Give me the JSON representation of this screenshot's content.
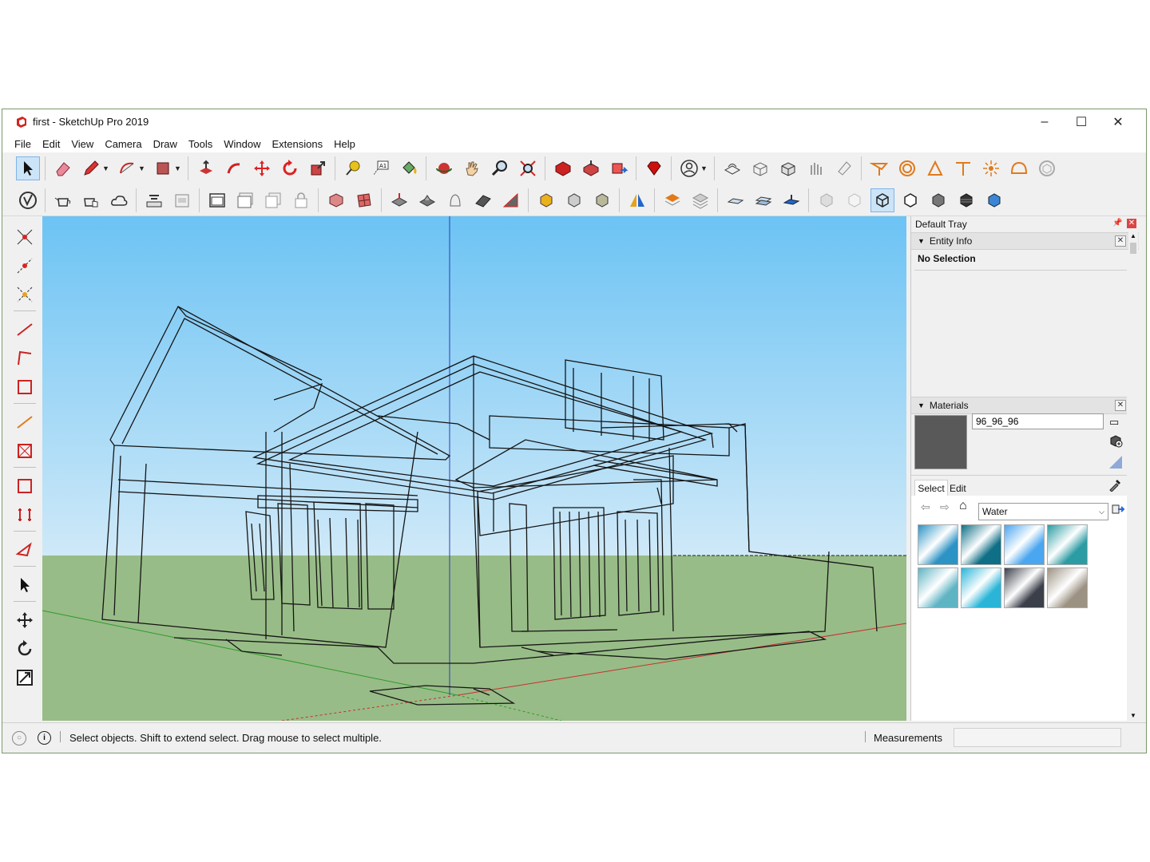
{
  "window": {
    "title": "first - SketchUp Pro 2019"
  },
  "menu": [
    "File",
    "Edit",
    "View",
    "Camera",
    "Draw",
    "Tools",
    "Window",
    "Extensions",
    "Help"
  ],
  "tray": {
    "title": "Default Tray",
    "entity_info": {
      "header": "Entity Info",
      "selection": "No Selection"
    },
    "materials": {
      "header": "Materials",
      "material_name": "96_96_96",
      "preview_color": "#595959",
      "tabs": [
        "Select",
        "Edit"
      ],
      "collection": "Water",
      "swatch_colors": [
        "#2c93c4",
        "#0f6f86",
        "#4aa6f0",
        "#2b9ca3",
        "#5fb4c4",
        "#2ab5d8",
        "#3b3f4a",
        "#9c9283"
      ]
    }
  },
  "status": {
    "hint": "Select objects. Shift to extend select. Drag mouse to select multiple.",
    "measurements_label": "Measurements",
    "measurements_value": ""
  },
  "colors": {
    "sky_top": "#6cc3f4",
    "sky_bottom": "#cfe9f8",
    "ground": "#98bc87",
    "accent": "#cce4f7",
    "tool_red": "#c8201c"
  }
}
